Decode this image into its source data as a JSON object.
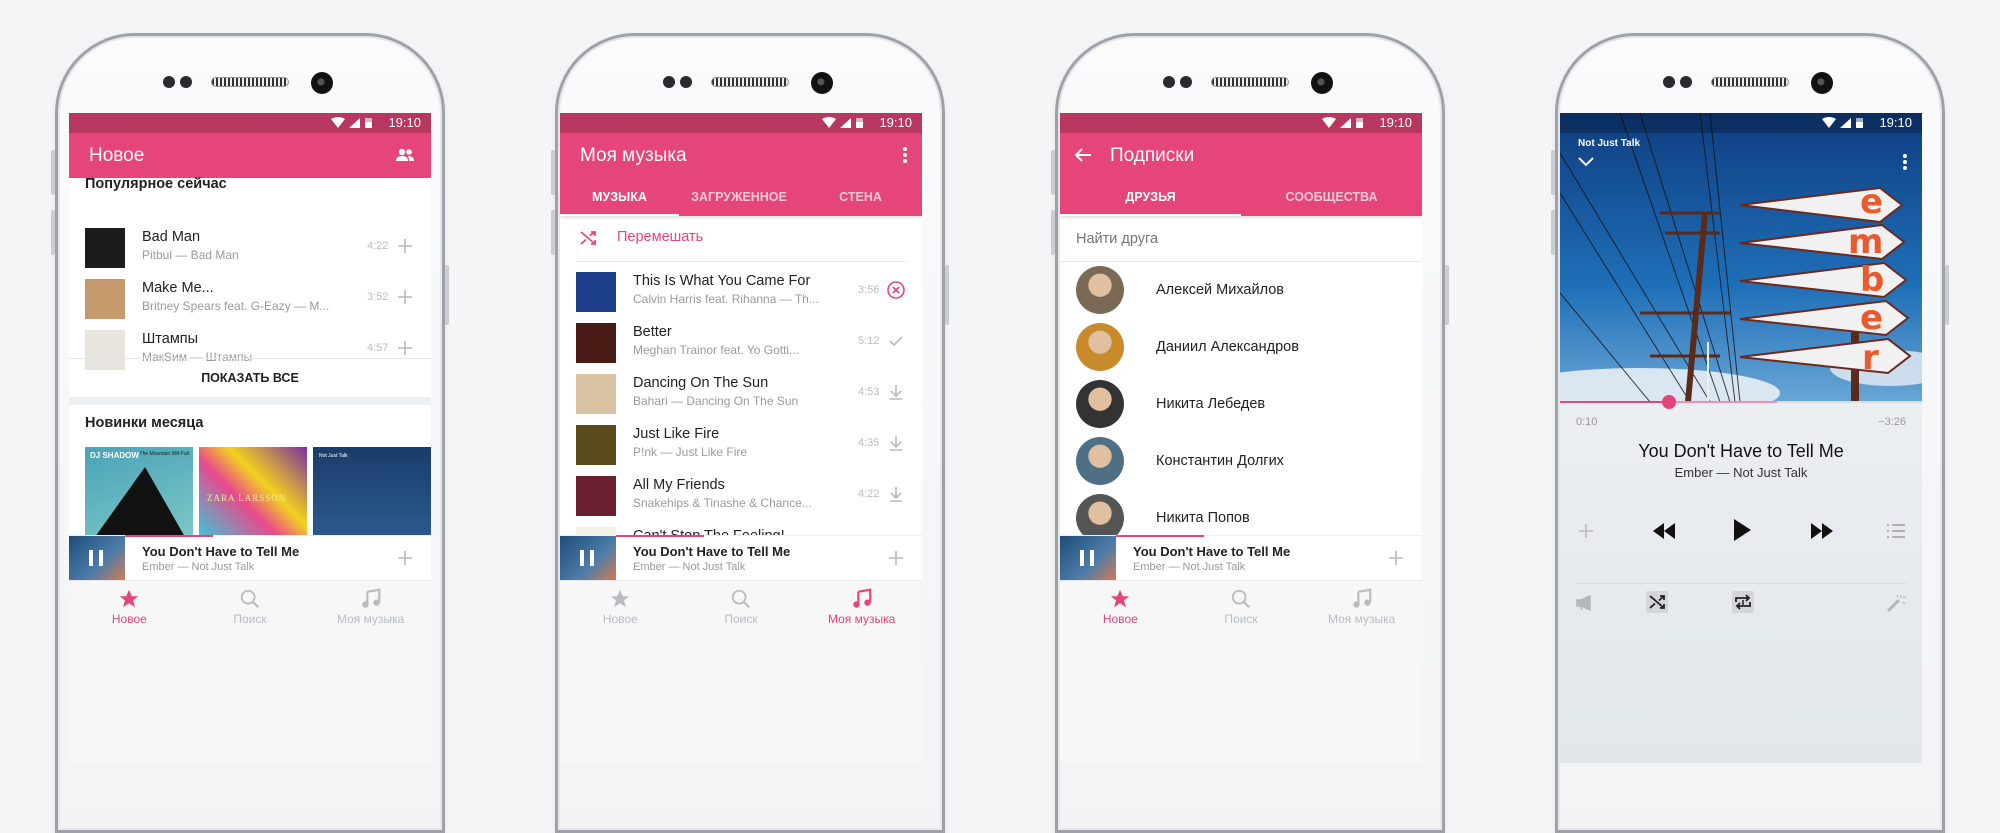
{
  "colors": {
    "accent": "#e6457a",
    "status_bar": "#b8375f",
    "background": "#f4f5f7"
  },
  "status": {
    "time": "19:10"
  },
  "bottom_nav": [
    {
      "label": "Новое",
      "icon": "star-icon"
    },
    {
      "label": "Поиск",
      "icon": "search-icon"
    },
    {
      "label": "Моя музыка",
      "icon": "music-note-icon"
    }
  ],
  "mini_player": {
    "title": "You Don't Have to Tell Me",
    "subtitle": "Ember — Not Just Talk"
  },
  "screen_new": {
    "title": "Новое",
    "popular_heading": "Популярное сейчас",
    "tracks": [
      {
        "title": "Bad Man",
        "subtitle": "Pitbul — Bad Man",
        "duration": "4:22",
        "action": "plus-icon",
        "thumb": "#1b1b1b"
      },
      {
        "title": "Make Me...",
        "subtitle": "Britney Spears feat. G-Eazy — M...",
        "duration": "3:52",
        "action": "plus-icon",
        "thumb": "#c49a6c"
      },
      {
        "title": "Штампы",
        "subtitle": "МакSим — Штампы",
        "duration": "4:57",
        "action": "plus-icon",
        "thumb": "#e8e4de"
      }
    ],
    "show_all": "ПОКАЗАТЬ ВСЕ",
    "new_heading": "Новинки месяца",
    "albums": [
      {
        "label": "DJ SHADOW",
        "sub": "The Mountain Will Fall"
      },
      {
        "label": "ZARA LARSSON",
        "sub": ""
      },
      {
        "label": "Not Just Talk",
        "sub": ""
      }
    ]
  },
  "screen_my_music": {
    "title": "Моя музыка",
    "tabs": [
      "МУЗЫКА",
      "ЗАГРУЖЕННОЕ",
      "СТЕНА"
    ],
    "shuffle": "Перемешать",
    "tracks": [
      {
        "title": "This Is What You Came For",
        "subtitle": "Calvin Harris feat. Rihanna — Th...",
        "duration": "3:56",
        "action": "cancel-download-icon",
        "thumb": "#1d3f8a"
      },
      {
        "title": "Better",
        "subtitle": "Meghan Trainor feat. Yo Gotti...",
        "duration": "5:12",
        "action": "check-icon",
        "thumb": "#4a1a14"
      },
      {
        "title": "Dancing On The Sun",
        "subtitle": "Bahari — Dancing On The Sun",
        "duration": "4:53",
        "action": "download-icon",
        "thumb": "#d9c2a2"
      },
      {
        "title": "Just Like Fire",
        "subtitle": "P!nk — Just Like Fire",
        "duration": "4:35",
        "action": "download-icon",
        "thumb": "#5a4a1c"
      },
      {
        "title": "All My Friends",
        "subtitle": "Snakehips & Tinashe & Chance...",
        "duration": "4:22",
        "action": "download-icon",
        "thumb": "#6a2030"
      },
      {
        "title": "Can't Stop The Feeling!",
        "subtitle": "",
        "duration": "",
        "action": "",
        "thumb": "#f5efe6"
      }
    ]
  },
  "screen_subs": {
    "title": "Подписки",
    "tabs": [
      "ДРУЗЬЯ",
      "СООБЩЕСТВА"
    ],
    "search_placeholder": "Найти друга",
    "friends": [
      {
        "name": "Алексей Михайлов",
        "avatar": "#7a6a55"
      },
      {
        "name": "Даниил Александров",
        "avatar": "#c98a2c"
      },
      {
        "name": "Никита Лебедев",
        "avatar": "#333333"
      },
      {
        "name": "Константин Долгих",
        "avatar": "#4f6f85"
      },
      {
        "name": "Никита Попов",
        "avatar": "#555555"
      }
    ]
  },
  "screen_player": {
    "album": "Not Just Talk",
    "art_text": "ember",
    "elapsed": "0:10",
    "remaining": "−3:26",
    "progress": 0.3,
    "buffered": 0.6,
    "title": "You Don't Have to Tell Me",
    "subtitle": "Ember — Not Just Talk"
  }
}
